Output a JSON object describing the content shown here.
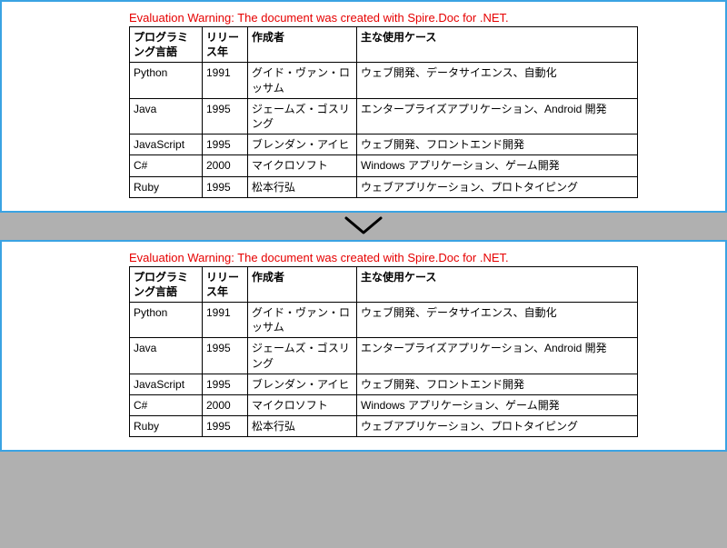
{
  "warning": "Evaluation Warning: The document was created with Spire.Doc for .NET.",
  "table": {
    "headers": {
      "lang": "プログラミング言語",
      "year": "リリース年",
      "creator": "作成者",
      "use": "主な使用ケース"
    },
    "rows": [
      {
        "lang": "Python",
        "year": "1991",
        "creator": "グイド・ヴァン・ロッサム",
        "use": "ウェブ開発、データサイエンス、自動化"
      },
      {
        "lang": "Java",
        "year": "1995",
        "creator": "ジェームズ・ゴスリング",
        "use": "エンタープライズアプリケーション、Android 開発"
      },
      {
        "lang": "JavaScript",
        "year": "1995",
        "creator": "ブレンダン・アイヒ",
        "use": "ウェブ開発、フロントエンド開発"
      },
      {
        "lang": "C#",
        "year": "2000",
        "creator": "マイクロソフト",
        "use": "Windows アプリケーション、ゲーム開発"
      },
      {
        "lang": "Ruby",
        "year": "1995",
        "creator": "松本行弘",
        "use": "ウェブアプリケーション、プロトタイピング"
      }
    ]
  }
}
